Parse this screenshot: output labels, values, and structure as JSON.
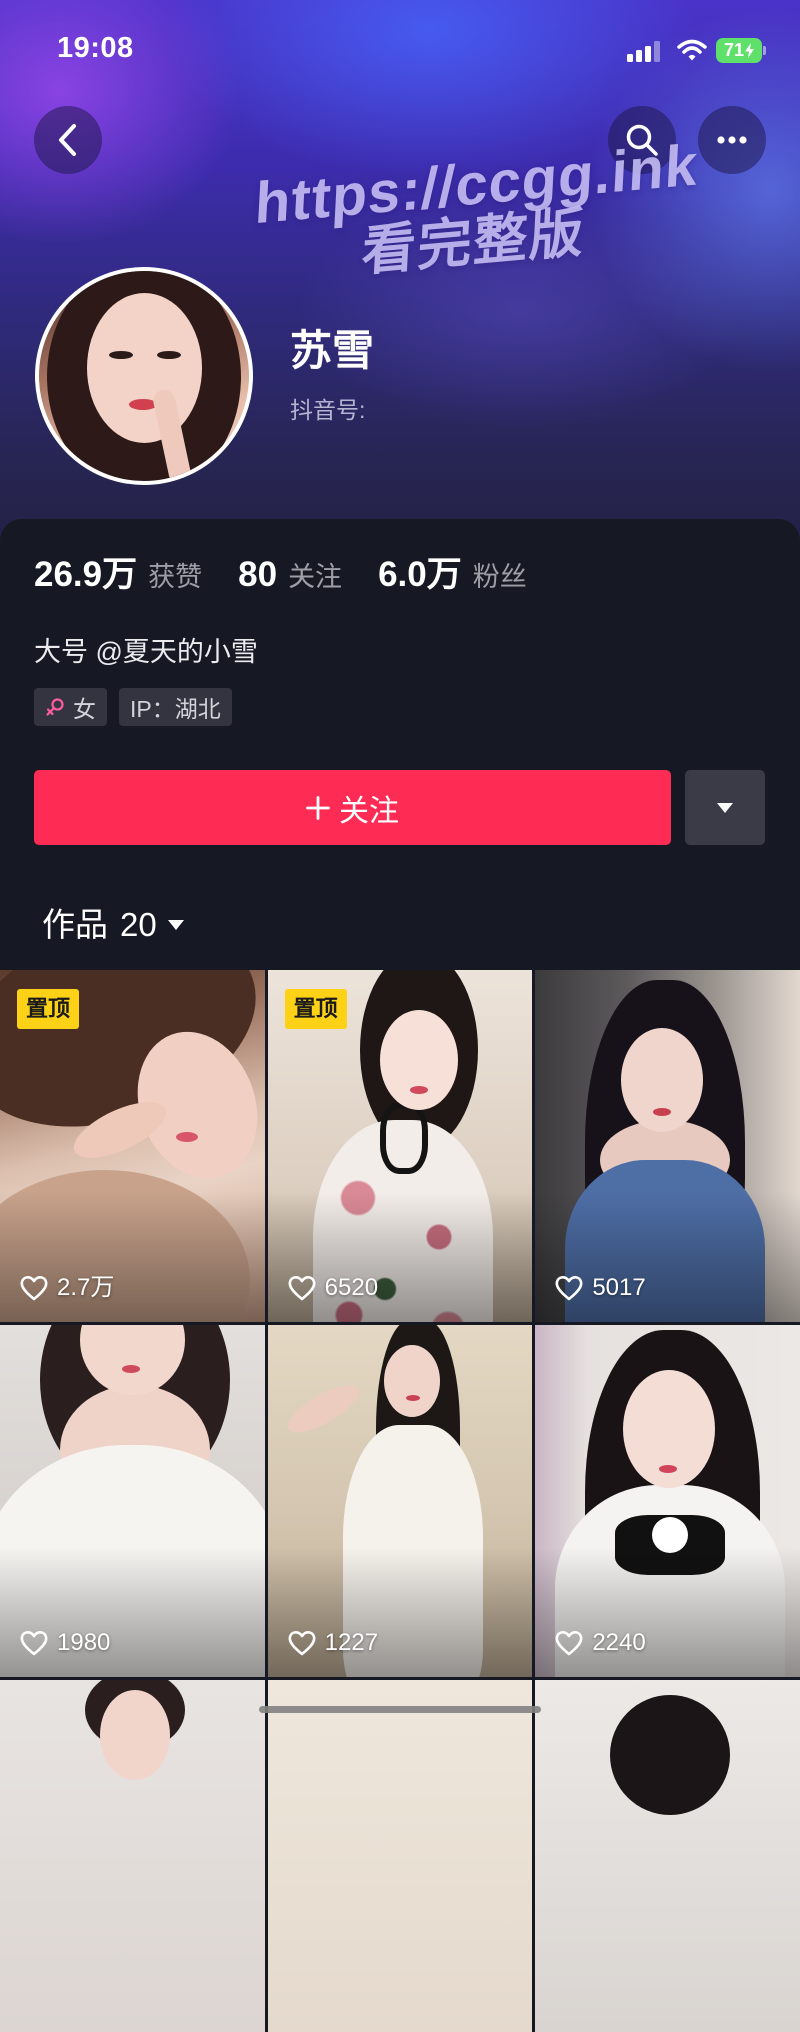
{
  "status_bar": {
    "time": "19:08",
    "battery_percent": "71",
    "icons": [
      "signal-icon",
      "wifi-icon",
      "battery-charging-icon"
    ]
  },
  "nav": {
    "icons": [
      "back-icon",
      "search-icon",
      "more-icon"
    ]
  },
  "watermark": {
    "line1": "https://ccgg.ink",
    "line2": "看完整版"
  },
  "profile": {
    "name": "苏雪",
    "id_label": "抖音号:",
    "stats": [
      {
        "value": "26.9万",
        "label": "获赞"
      },
      {
        "value": "80",
        "label": "关注"
      },
      {
        "value": "6.0万",
        "label": "粉丝"
      }
    ],
    "bio": "大号 @夏天的小雪",
    "tags": [
      {
        "icon": "female-icon",
        "label": "女"
      },
      {
        "label": "IP：湖北"
      }
    ]
  },
  "actions": {
    "follow_label": "关注",
    "follow_icon": "plus-icon",
    "more_icon": "triangle-down-icon"
  },
  "works": {
    "tab_label": "作品",
    "count": "20"
  },
  "grid": {
    "items": [
      {
        "likes": "2.7万",
        "badge": "置顶"
      },
      {
        "likes": "6520",
        "badge": "置顶"
      },
      {
        "likes": "5017"
      },
      {
        "likes": "1980"
      },
      {
        "likes": "1227"
      },
      {
        "likes": "2240"
      }
    ]
  },
  "colors": {
    "accent": "#fe2c55",
    "panel": "#161823",
    "pinned_badge": "#fcd116",
    "battery": "#5fe06b",
    "female_icon": "#ff5c9e"
  }
}
